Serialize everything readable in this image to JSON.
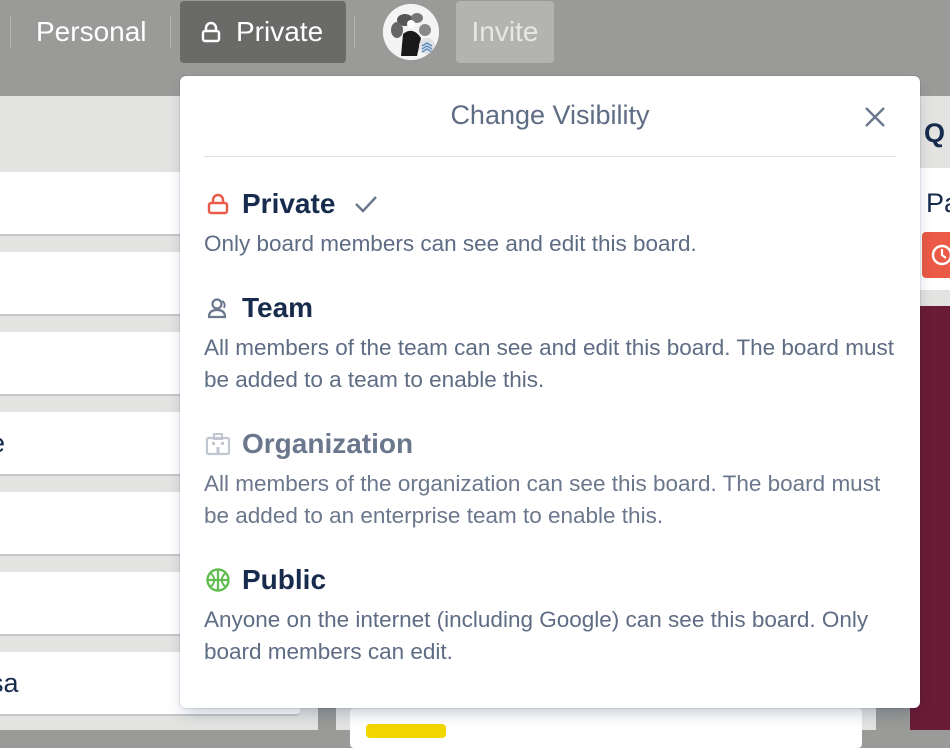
{
  "header": {
    "personal_label": "Personal",
    "private_label": "Private",
    "invite_label": "Invite"
  },
  "left_list": {
    "cards": [
      "",
      "",
      "",
      "e",
      "",
      "",
      "sa"
    ]
  },
  "right_list": {
    "title": "Q",
    "card_text": "Pa"
  },
  "popover": {
    "title": "Change Visibility",
    "options": [
      {
        "name": "Private",
        "description": "Only board members can see and edit this board.",
        "icon": "lock-icon",
        "selected": true,
        "icon_color": "#eb5a46"
      },
      {
        "name": "Team",
        "description": "All members of the team can see and edit this board. The board must be added to a team to enable this.",
        "icon": "team-icon",
        "selected": false,
        "icon_color": "#6b778c"
      },
      {
        "name": "Organization",
        "description": "All members of the organization can see this board. The board must be added to an enterprise team to enable this.",
        "icon": "organization-icon",
        "selected": false,
        "disabled": true,
        "icon_color": "#c1c7d0"
      },
      {
        "name": "Public",
        "description": "Anyone on the internet (including Google) can see this board. Only board members can edit.",
        "icon": "globe-icon",
        "selected": false,
        "icon_color": "#61bd4f"
      }
    ]
  },
  "colors": {
    "header_bg": "#9a9a98",
    "selected_button_bg": "#6a6a69",
    "private_icon": "#eb5a46",
    "public_icon": "#61bd4f",
    "label_yellow": "#f2d600",
    "right_badge": "#eb5a46"
  }
}
